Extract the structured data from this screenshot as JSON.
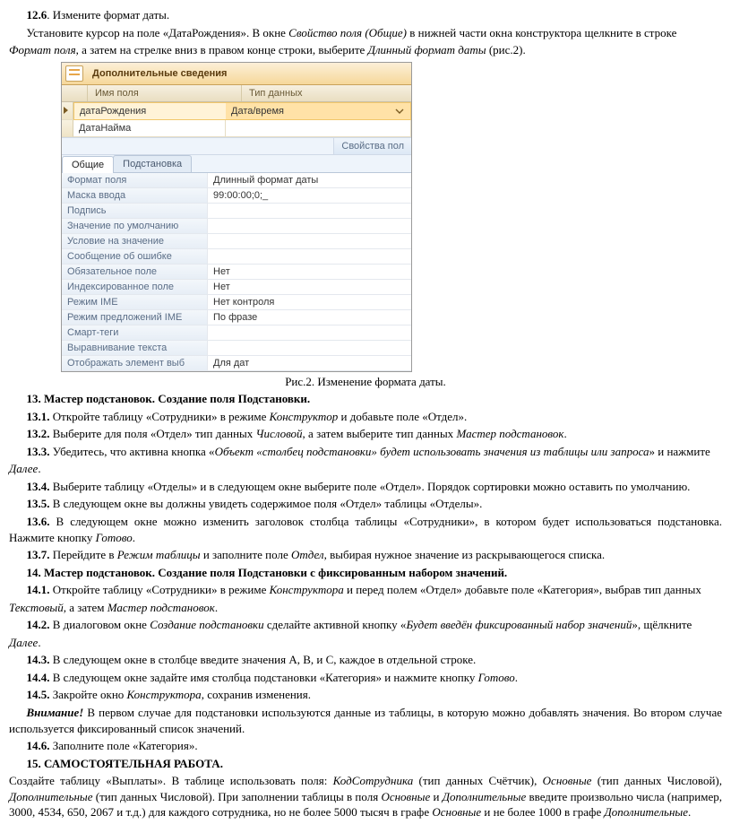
{
  "para": {
    "p126_a": "12.6",
    "p126_b": ". Измените формат даты.",
    "p126_line2_a": "Установите курсор на поле «ДатаРождения». В окне ",
    "p126_line2_b": "Свойство поля (Общие)",
    "p126_line2_c": " в нижней части окна конструктора щелкните в строке ",
    "p126_line3_a": "Формат поля",
    "p126_line3_b": ", а затем на стрелке вниз в правом конце строки, выберите ",
    "p126_line3_c": "Длинный формат даты",
    "p126_line3_d": " (рис.2).",
    "fig_caption": "Рис.2. Изменение формата даты.",
    "h13": "13. Мастер подстановок. Создание поля Подстановки.",
    "p131_a": "13.1.",
    "p131_b": " Откройте таблицу «Сотрудники» в режиме ",
    "p131_c": "Конструктор",
    "p131_d": " и добавьте поле «Отдел».",
    "p132_a": "13.2.",
    "p132_b": " Выберите для поля «Отдел» тип данных ",
    "p132_c": "Числовой",
    "p132_d": ", а затем выберите тип данных ",
    "p132_e": "Мастер подстановок",
    "p132_f": ".",
    "p133_a": "13.3.",
    "p133_b": " Убедитесь, что активна кнопка «",
    "p133_c": "Объект «столбец подстановки» будет использовать значения из таблицы или запроса",
    "p133_d": "» и нажмите ",
    "p133_e": "Далее",
    "p133_f": ".",
    "p134_a": "13.4.",
    "p134_b": " Выберите таблицу «Отделы» и в следующем окне выберите поле «Отдел». Порядок сортировки можно оставить по умолчанию.",
    "p135_a": "13.5.",
    "p135_b": " В следующем окне вы должны увидеть содержимое поля «Отдел» таблицы «Отделы».",
    "p136_a": "13.6.",
    "p136_b": " В следующем окне можно изменить заголовок столбца таблицы «Сотрудники», в котором будет использоваться подстановка. Нажмите кнопку ",
    "p136_c": "Готово",
    "p136_d": ".",
    "p137_a": "13.7.",
    "p137_b": " Перейдите в ",
    "p137_c": "Режим таблицы",
    "p137_d": " и заполните поле ",
    "p137_e": "Отдел",
    "p137_f": ", выбирая нужное значение из раскрывающегося списка.",
    "h14": "14. Мастер подстановок. Создание поля Подстановки с фиксированным набором значений.",
    "p141_a": "14.1.",
    "p141_b": " Откройте таблицу «Сотрудники» в режиме ",
    "p141_c": "Конструктора",
    "p141_d": " и перед полем «Отдел» добавьте поле «Категория», выбрав тип данных ",
    "p141_e": "Текстовый",
    "p141_f": ", а затем ",
    "p141_g": "Мастер подстановок",
    "p141_h": ".",
    "p142_a": "14.2.",
    "p142_b": " В диалоговом окне ",
    "p142_c": "Создание подстановки",
    "p142_d": " сделайте активной кнопку «",
    "p142_e": "Будет введён фиксированный набор значений",
    "p142_f": "», щёлкните ",
    "p142_g": "Далее",
    "p142_h": ".",
    "p143_a": "14.3.",
    "p143_b": " В следующем окне в столбце введите значения A, B, и C, каждое в отдельной строке.",
    "p144_a": "14.4.",
    "p144_b": " В следующем окне задайте имя столбца подстановки «Категория» и нажмите кнопку ",
    "p144_c": "Готово",
    "p144_d": ".",
    "p145_a": "14.5.",
    "p145_b": " Закройте окно ",
    "p145_c": "Конструктора",
    "p145_d": ", сохранив изменения.",
    "warn_a": "Внимание!",
    "warn_b": " В первом случае для подстановки используются данные из таблицы, в которую можно добавлять значения. Во втором случае используется фиксированный список значений.",
    "p146_a": "14.6.",
    "p146_b": " Заполните поле «Категория».",
    "h15": "15. САМОСТОЯТЕЛЬНАЯ РАБОТА.",
    "task_a": "Создайте таблицу «Выплаты». В таблице использовать поля: ",
    "task_b": "КодСотрудника",
    "task_c": " (тип данных Счётчик), ",
    "task_d": "Основные",
    "task_e": " (тип данных Числовой), ",
    "task_f": "Дополнительные",
    "task_g": " (тип данных Числовой). При заполнении таблицы в поля ",
    "task_h": "Основные",
    "task_i": " и ",
    "task_j": "Дополнительные",
    "task_k": " введите произвольно числа (например, 3000, 4534, 650, 2067 и т.д.) для каждого сотрудника, но не более 5000 тысяч в графе ",
    "task_l": "Основные",
    "task_m": " и не более 1000 в графе ",
    "task_n": "Дополнительные",
    "task_o": "."
  },
  "shot": {
    "banner": "Дополнительные сведения",
    "col_a": "Имя поля",
    "col_b": "Тип данных",
    "rows": [
      {
        "a": "датаРождения",
        "b": "Дата/время",
        "active": true
      },
      {
        "a": "ДатаНайма",
        "b": "",
        "active": false
      }
    ],
    "pill": "Свойства пол",
    "tabs": {
      "a": "Общие",
      "b": "Подстановка"
    },
    "props": [
      {
        "l": "Формат поля",
        "v": "Длинный формат даты"
      },
      {
        "l": "Маска ввода",
        "v": "99:00:00;0;_"
      },
      {
        "l": "Подпись",
        "v": ""
      },
      {
        "l": "Значение по умолчанию",
        "v": ""
      },
      {
        "l": "Условие на значение",
        "v": ""
      },
      {
        "l": "Сообщение об ошибке",
        "v": ""
      },
      {
        "l": "Обязательное поле",
        "v": "Нет"
      },
      {
        "l": "Индексированное поле",
        "v": "Нет"
      },
      {
        "l": "Режим IME",
        "v": "Нет контроля"
      },
      {
        "l": "Режим предложений IME",
        "v": "По фразе"
      },
      {
        "l": "Смарт-теги",
        "v": ""
      },
      {
        "l": "Выравнивание текста",
        "v": ""
      },
      {
        "l": "Отображать элемент выб",
        "v": "Для дат"
      }
    ]
  }
}
